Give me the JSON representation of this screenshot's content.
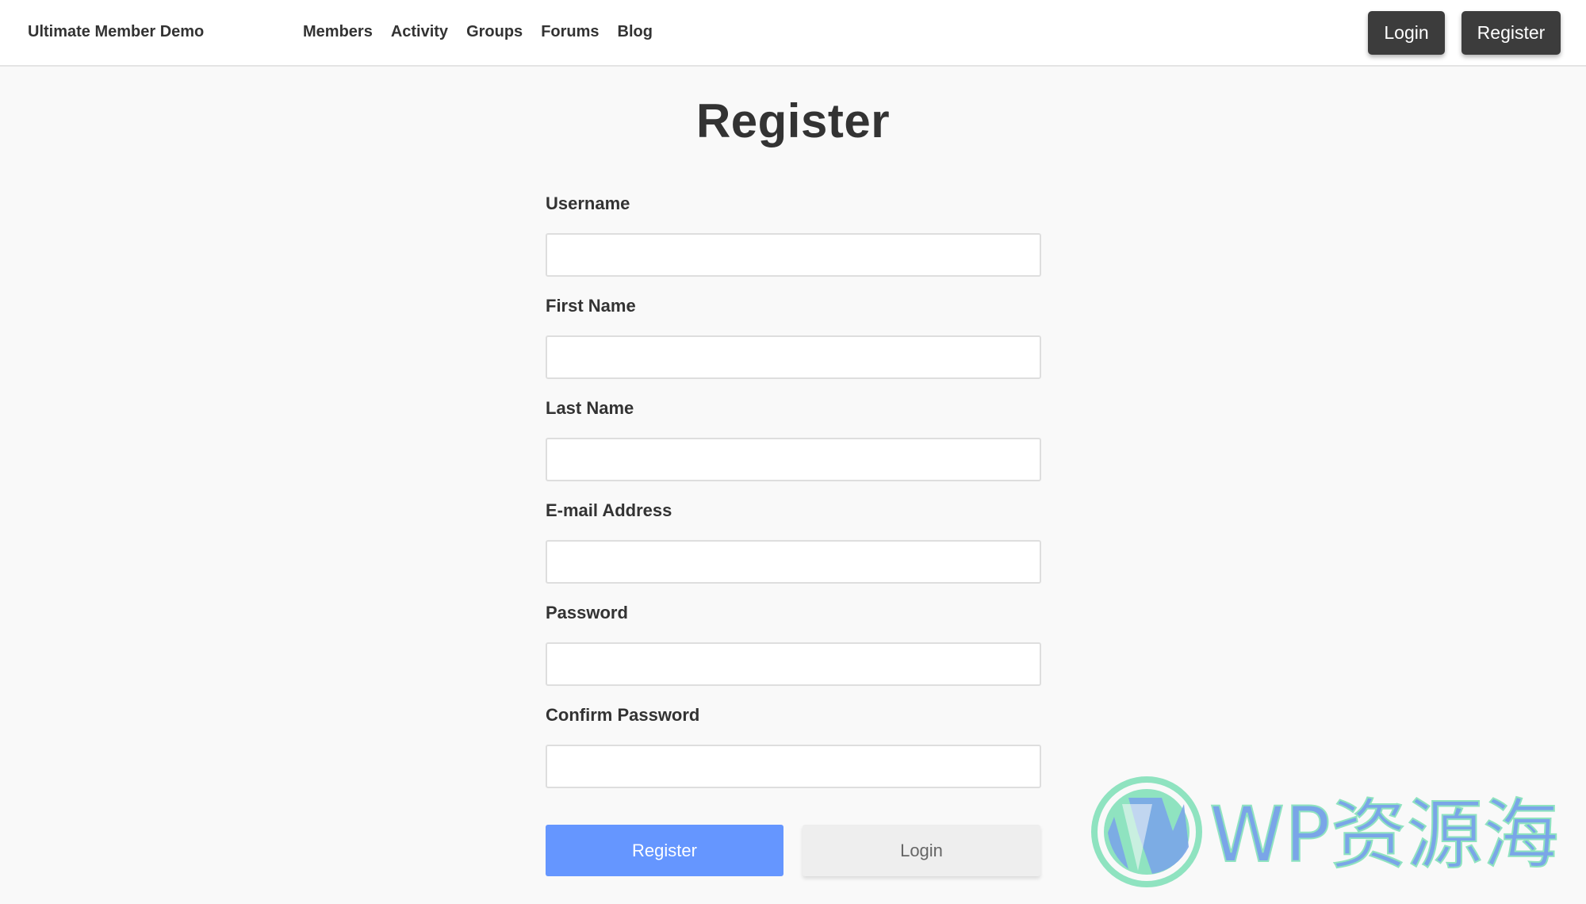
{
  "site": {
    "title": "Ultimate Member Demo"
  },
  "nav": [
    {
      "label": "Members"
    },
    {
      "label": "Activity"
    },
    {
      "label": "Groups"
    },
    {
      "label": "Forums"
    },
    {
      "label": "Blog"
    }
  ],
  "header_buttons": {
    "login": "Login",
    "register": "Register"
  },
  "page": {
    "title": "Register"
  },
  "form": {
    "fields": [
      {
        "label": "Username",
        "value": ""
      },
      {
        "label": "First Name",
        "value": ""
      },
      {
        "label": "Last Name",
        "value": ""
      },
      {
        "label": "E-mail Address",
        "value": ""
      },
      {
        "label": "Password",
        "value": ""
      },
      {
        "label": "Confirm Password",
        "value": ""
      }
    ],
    "register_label": "Register",
    "login_label": "Login"
  },
  "watermark": {
    "text": "WP资源海",
    "icon": "wordpress-logo"
  },
  "colors": {
    "primary": "#6596ff",
    "header_button": "#3c3c3c",
    "background": "#f9f9f9",
    "secondary_button": "#eeeeee",
    "watermark_green": "#8fe3c0",
    "watermark_blue": "#7aa5e8"
  }
}
